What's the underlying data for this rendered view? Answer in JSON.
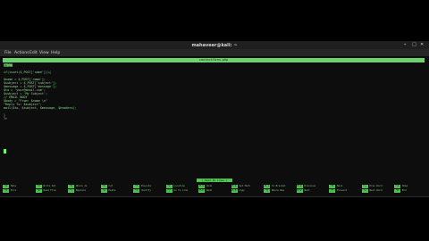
{
  "window": {
    "title": "mahaveer@kali: ~",
    "controls": [
      "–",
      "□",
      "✕"
    ]
  },
  "menu": [
    "File",
    "Actions",
    "Edit",
    "View",
    "Help"
  ],
  "editor": {
    "filename": "contactform.php",
    "lines": [
      "<?php",
      "",
      "if(isset($_POST['name'])){",
      "",
      "$name = $_POST['name'];",
      "$subject = $_POST['subject'];",
      "$message = $_POST['message'];",
      "$to = 'your@email.com';",
      "$subject = 'My Subject';",
      "// EMAIL BODY",
      "$body = \"From: $name \\n\"",
      "\"Reply To: $subject\";",
      "mail($to, $subject, $message, $headers);",
      "",
      "}",
      "?>"
    ],
    "cursor_line": 16
  },
  "status": "[ Read 16 lines ]",
  "shortcuts": {
    "row1": [
      {
        "key": "^G",
        "label": "Help"
      },
      {
        "key": "^O",
        "label": "Write Out"
      },
      {
        "key": "^W",
        "label": "Where Is"
      },
      {
        "key": "^K",
        "label": "Cut"
      },
      {
        "key": "^T",
        "label": "Execute"
      },
      {
        "key": "^C",
        "label": "Location"
      },
      {
        "key": "M-U",
        "label": "Undo"
      },
      {
        "key": "M-A",
        "label": "Set Mark"
      },
      {
        "key": "M-]",
        "label": "To Bracket"
      },
      {
        "key": "M-Q",
        "label": "Previous"
      },
      {
        "key": "^B",
        "label": "Back"
      },
      {
        "key": "^◂",
        "label": "Prev Word"
      },
      {
        "key": "^A",
        "label": "Home"
      }
    ],
    "row2": [
      {
        "key": "^X",
        "label": "Exit"
      },
      {
        "key": "^R",
        "label": "Read File"
      },
      {
        "key": "^\\",
        "label": "Replace"
      },
      {
        "key": "^U",
        "label": "Paste"
      },
      {
        "key": "^J",
        "label": "Justify"
      },
      {
        "key": "^/",
        "label": "Go To Line"
      },
      {
        "key": "M-E",
        "label": "Redo"
      },
      {
        "key": "M-6",
        "label": "Copy"
      },
      {
        "key": "^Q",
        "label": "Where Was"
      },
      {
        "key": "M-W",
        "label": "Next"
      },
      {
        "key": "^F",
        "label": "Forward"
      },
      {
        "key": "^▸",
        "label": "Next Word"
      },
      {
        "key": "^E",
        "label": "End"
      }
    ]
  }
}
